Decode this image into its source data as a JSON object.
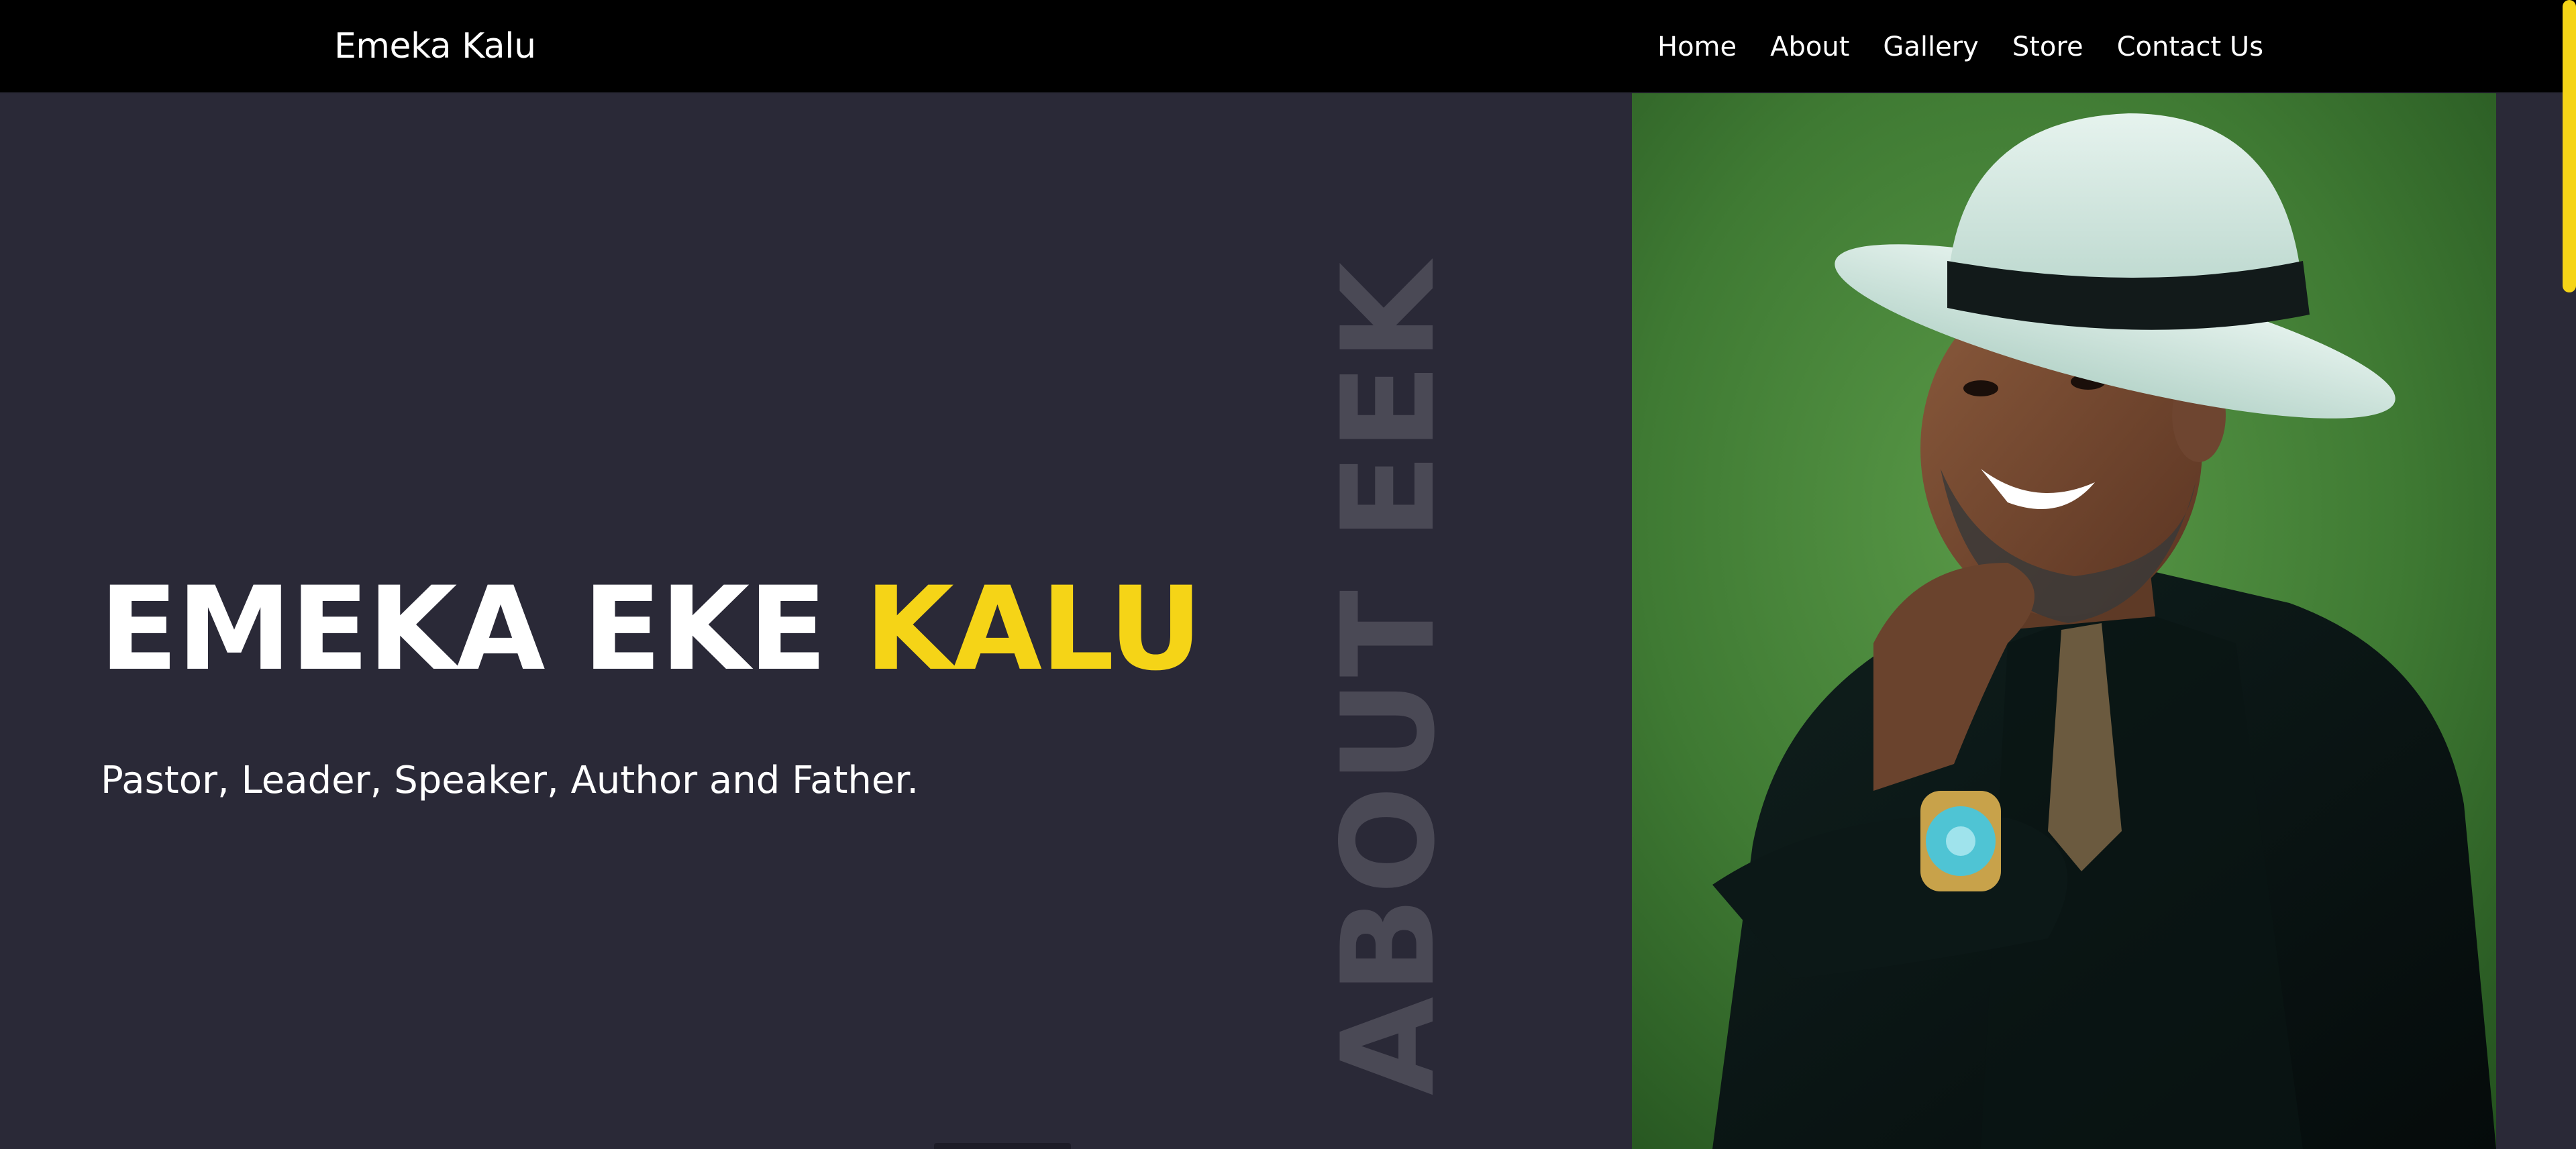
{
  "navbar": {
    "brand": "Emeka Kalu",
    "links": [
      {
        "label": "Home"
      },
      {
        "label": "About"
      },
      {
        "label": "Gallery"
      },
      {
        "label": "Store"
      },
      {
        "label": "Contact Us"
      }
    ]
  },
  "hero": {
    "title_main": "EMEKA EKE",
    "title_accent": "KALU",
    "subtitle": "Pastor, Leader, Speaker, Author and Father.",
    "vertical_heading": "ABOUT EEK"
  },
  "portrait": {
    "alt_icon": "portrait-photo"
  },
  "colors": {
    "background": "#2a2937",
    "navbar": "#000000",
    "accent": "#f5d417",
    "text": "#ffffff",
    "watermark": "#4a4955",
    "photo_bg": "#3f7a33"
  }
}
